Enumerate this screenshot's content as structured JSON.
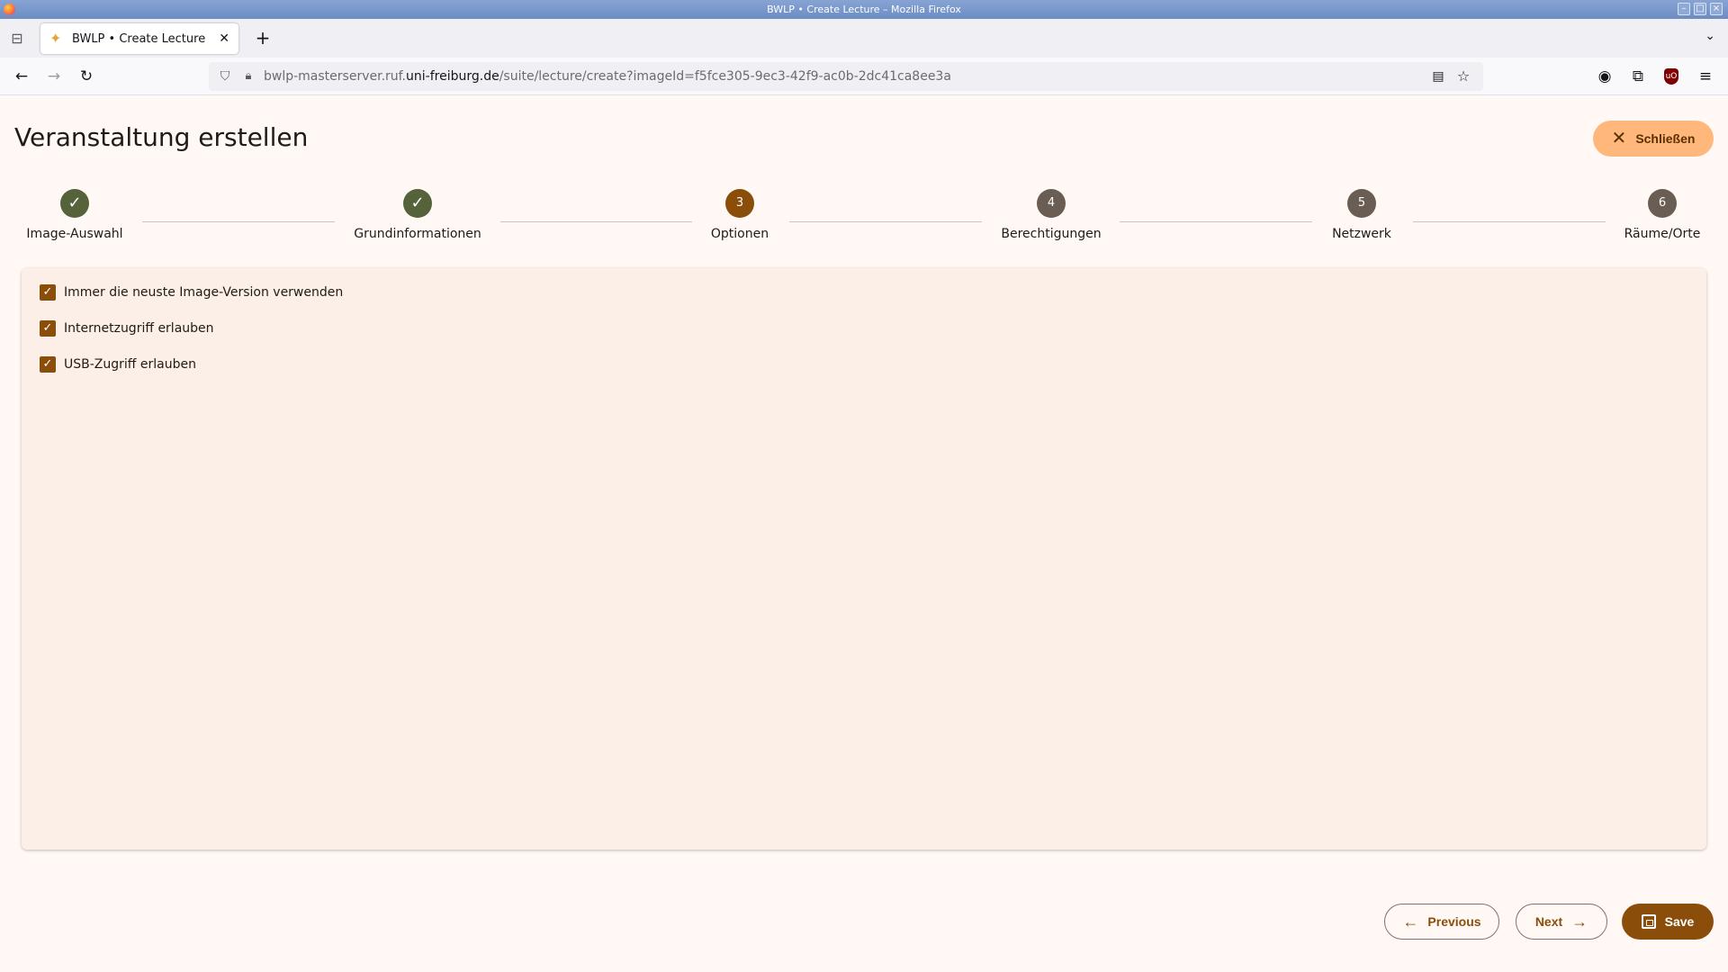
{
  "window": {
    "title": "BWLP • Create Lecture – Mozilla Firefox"
  },
  "browser": {
    "tab_title": "BWLP • Create Lecture",
    "url_prefix": "bwlp-masterserver.ruf.",
    "url_host": "uni-freiburg.de",
    "url_path": "/suite/lecture/create?imageId=f5fce305-9ec3-42f9-ac0b-2dc41ca8ee3a"
  },
  "page": {
    "title": "Veranstaltung erstellen",
    "close_label": "Schließen"
  },
  "steps": [
    {
      "number": "1",
      "label": "Image-Auswahl",
      "state": "done"
    },
    {
      "number": "2",
      "label": "Grundinformationen",
      "state": "done"
    },
    {
      "number": "3",
      "label": "Optionen",
      "state": "active"
    },
    {
      "number": "4",
      "label": "Berechtigungen",
      "state": "todo"
    },
    {
      "number": "5",
      "label": "Netzwerk",
      "state": "todo"
    },
    {
      "number": "6",
      "label": "Räume/Orte",
      "state": "todo"
    }
  ],
  "options": [
    {
      "label": "Immer die neuste Image-Version verwenden",
      "checked": true
    },
    {
      "label": "Internetzugriff erlauben",
      "checked": true
    },
    {
      "label": "USB-Zugriff erlauben",
      "checked": true
    }
  ],
  "footer": {
    "previous_label": "Previous",
    "next_label": "Next",
    "save_label": "Save"
  },
  "colors": {
    "primary": "#8b4e0a",
    "done": "#55623a",
    "todo": "#6a5d53",
    "close_button": "#ffb77c",
    "background": "#fff8f5",
    "card": "#fcefe7"
  }
}
